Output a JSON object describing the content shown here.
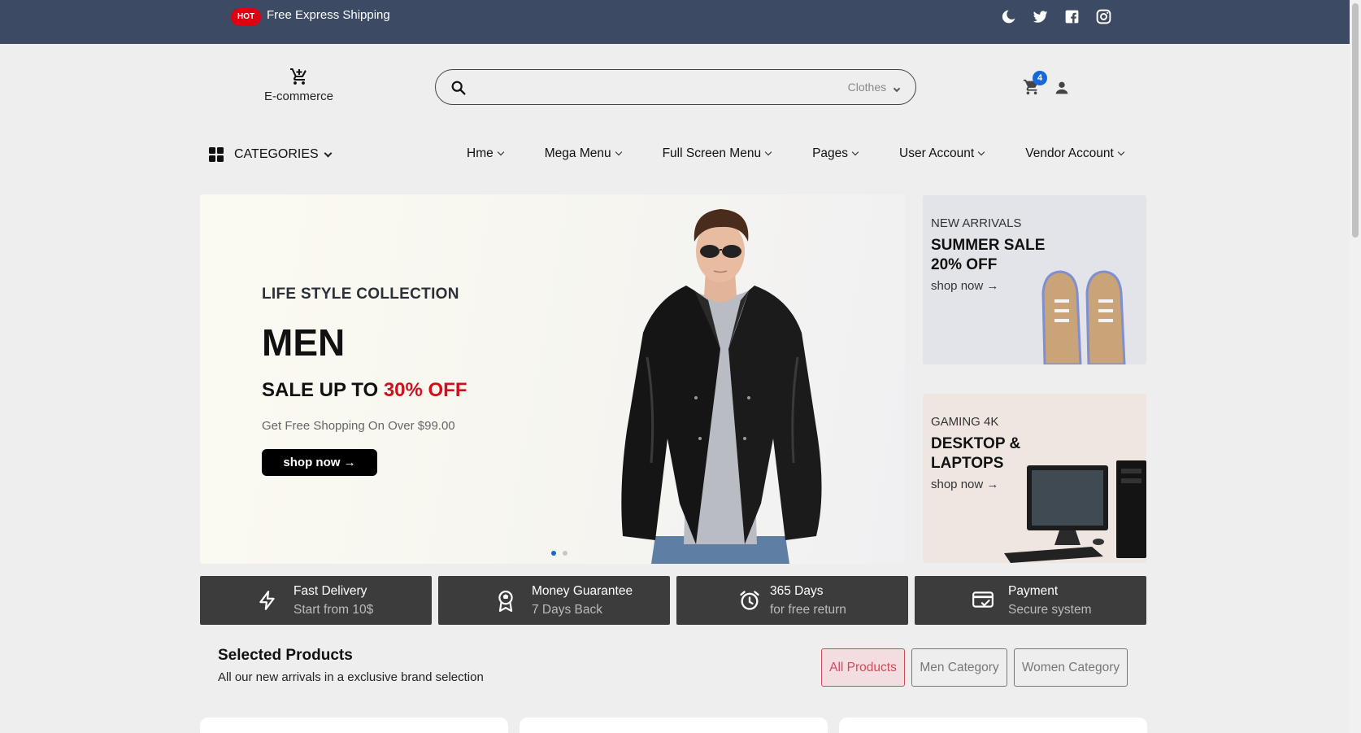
{
  "topbar": {
    "hot_badge": "HOT",
    "shipping_text": "Free Express Shipping",
    "icons": [
      "moon-icon",
      "twitter-icon",
      "facebook-icon",
      "instagram-icon"
    ]
  },
  "header": {
    "logo_text": "E-commerce",
    "search": {
      "placeholder": "",
      "category": "Clothes"
    },
    "cart_count": "4"
  },
  "nav": {
    "categories_label": "CATEGORIES",
    "items": [
      {
        "label": "Hme"
      },
      {
        "label": "Mega Menu"
      },
      {
        "label": "Full Screen Menu"
      },
      {
        "label": "Pages"
      },
      {
        "label": "User Account"
      },
      {
        "label": "Vendor Account"
      }
    ]
  },
  "hero": {
    "kicker": "LIFE STYLE COLLECTION",
    "title": "MEN",
    "sale_prefix": "SALE UP TO ",
    "sale_highlight": "30% OFF",
    "subtitle": "Get Free Shopping On Over $99.00",
    "button": "shop now →",
    "slides": 2,
    "active_slide": 1
  },
  "promos": [
    {
      "kicker": "NEW ARRIVALS",
      "title": "SUMMER SALE 20% OFF",
      "link": "shop now →"
    },
    {
      "kicker": "GAMING 4K",
      "title": "DESKTOP & LAPTOPS",
      "link": "shop now →"
    }
  ],
  "features": [
    {
      "title": "Fast Delivery",
      "subtitle": "Start from 10$",
      "icon": "lightning-icon"
    },
    {
      "title": "Money Guarantee",
      "subtitle": "7 Days Back",
      "icon": "award-icon"
    },
    {
      "title": "365 Days",
      "subtitle": "for free return",
      "icon": "alarm-clock-icon"
    },
    {
      "title": "Payment",
      "subtitle": "Secure system",
      "icon": "credit-card-icon"
    }
  ],
  "selected": {
    "title": "Selected Products",
    "subtitle": "All our new arrivals in a exclusive brand selection",
    "filters": [
      {
        "label": "All Products",
        "active": true
      },
      {
        "label": "Men Category",
        "active": false
      },
      {
        "label": "Women Category",
        "active": false
      }
    ]
  },
  "colors": {
    "topbar": "#3d4a63",
    "hot": "#e1000f",
    "accent_blue": "#1669d8",
    "sale_red": "#d0101c",
    "feature_bg": "#3c3c3c",
    "filter_active": "#d04a5a"
  }
}
